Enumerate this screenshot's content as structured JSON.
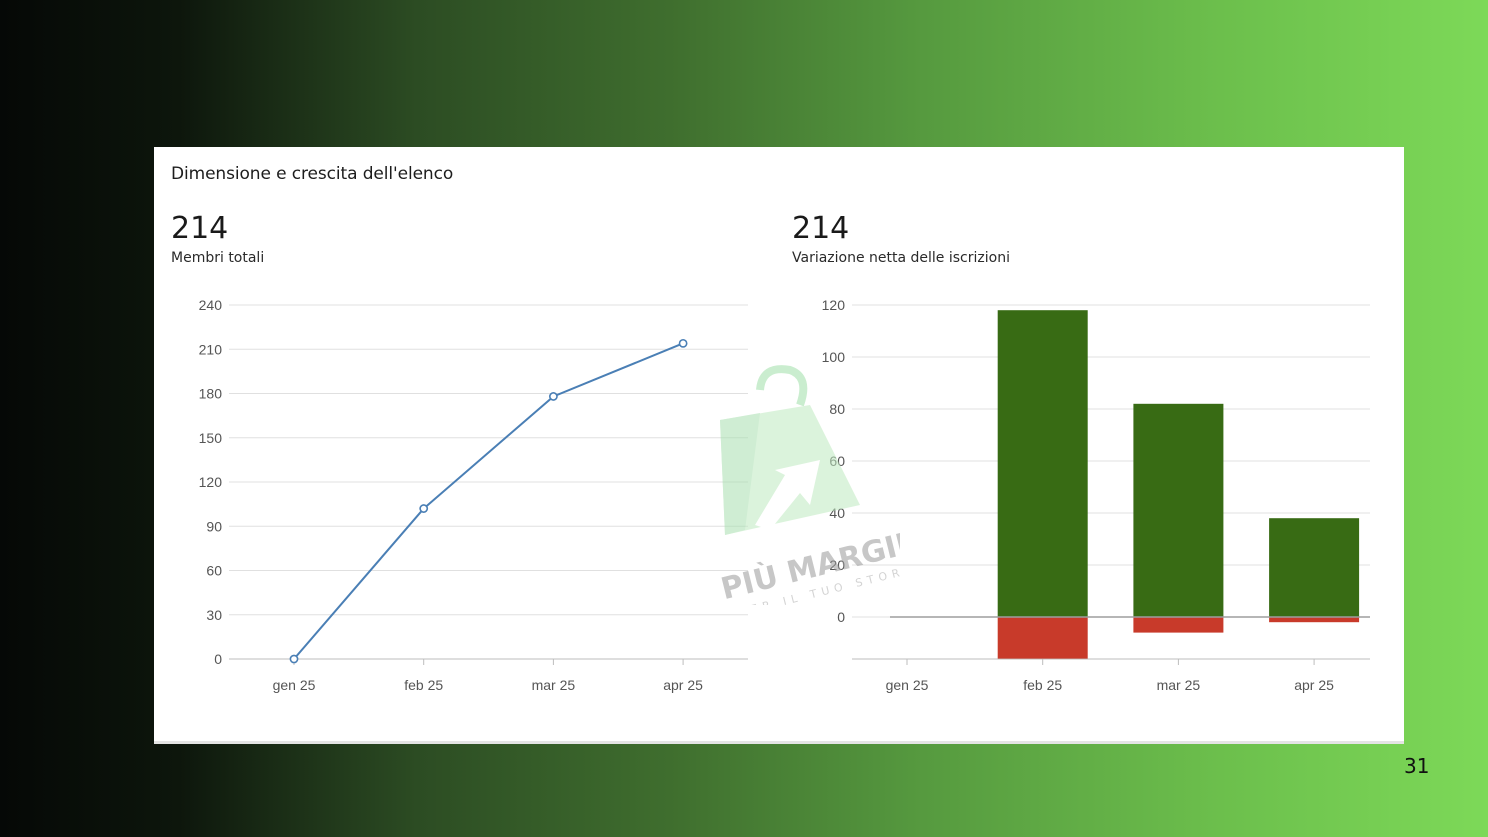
{
  "card": {
    "title": "Dimensione e crescita dell'elenco",
    "left_metric": {
      "value": "214",
      "label": "Membri totali"
    },
    "right_metric": {
      "value": "214",
      "label": "Variazione netta delle iscrizioni"
    }
  },
  "page_number": "31",
  "watermark": {
    "text": "PIÙ MARGINI",
    "subtext": "PER IL TUO STORE"
  },
  "colors": {
    "line": "#4a7fb5",
    "gain": "#386b14",
    "loss": "#c83a2a"
  },
  "chart_data": [
    {
      "type": "line",
      "categories": [
        "gen 25",
        "feb 25",
        "mar 25",
        "apr 25"
      ],
      "series": [
        {
          "values": [
            0,
            102,
            178,
            214
          ]
        }
      ],
      "ylim": [
        0,
        240
      ],
      "yticks": [
        0,
        30,
        60,
        90,
        120,
        150,
        180,
        210,
        240
      ],
      "grid": true
    },
    {
      "type": "bar",
      "stacked": true,
      "categories": [
        "gen 25",
        "feb 25",
        "mar 25",
        "apr 25"
      ],
      "series": [
        {
          "values": [
            0,
            118,
            82,
            38
          ]
        },
        {
          "values": [
            0,
            -16,
            -6,
            -2
          ]
        }
      ],
      "ylim": [
        -16,
        120
      ],
      "yticks": [
        0,
        20,
        40,
        60,
        80,
        100,
        120
      ],
      "grid": true
    }
  ]
}
